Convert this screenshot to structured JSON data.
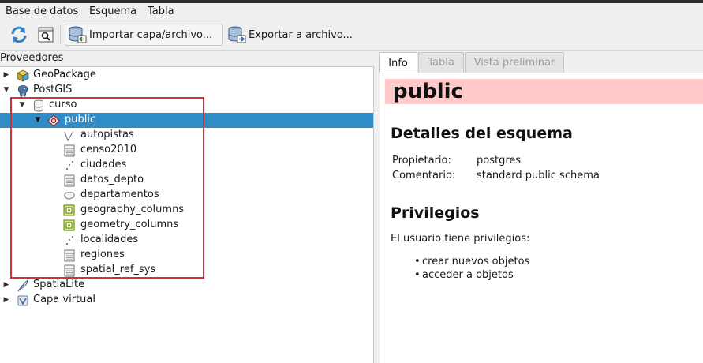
{
  "menu": [
    "Base de datos",
    "Esquema",
    "Tabla"
  ],
  "toolbar": {
    "refresh_icon": "refresh-icon",
    "sql_icon": "sql-window-icon",
    "import_label": "Importar capa/archivo...",
    "export_label": "Exportar a archivo..."
  },
  "left_panel": {
    "title": "Proveedores"
  },
  "tree": {
    "geopackage": "GeoPackage",
    "postgis": "PostGIS",
    "curso": "curso",
    "public": "public",
    "tables": [
      {
        "name": "autopistas",
        "icon": "line-layer-icon"
      },
      {
        "name": "censo2010",
        "icon": "table-icon"
      },
      {
        "name": "ciudades",
        "icon": "point-layer-icon"
      },
      {
        "name": "datos_depto",
        "icon": "table-icon"
      },
      {
        "name": "departamentos",
        "icon": "polygon-layer-icon"
      },
      {
        "name": "geography_columns",
        "icon": "view-icon"
      },
      {
        "name": "geometry_columns",
        "icon": "view-icon"
      },
      {
        "name": "localidades",
        "icon": "point-layer-icon"
      },
      {
        "name": "regiones",
        "icon": "table-icon"
      },
      {
        "name": "spatial_ref_sys",
        "icon": "table-icon"
      }
    ],
    "spatialite": "SpatiaLite",
    "virtual": "Capa virtual"
  },
  "tabs": [
    {
      "label": "Info",
      "active": true
    },
    {
      "label": "Tabla",
      "active": false
    },
    {
      "label": "Vista preliminar",
      "active": false
    }
  ],
  "info": {
    "schema_name": "public",
    "details_heading": "Detalles del esquema",
    "owner_key": "Propietario:",
    "owner_value": "postgres",
    "comment_key": "Comentario:",
    "comment_value": "standard public schema",
    "privileges_heading": "Privilegios",
    "privileges_text": "El usuario tiene privilegios:",
    "privileges": [
      "crear nuevos objetos",
      "acceder a objetos"
    ]
  },
  "colors": {
    "selection": "#308cc6",
    "schema_header_bg": "#ffc9c9",
    "highlight_box": "#d0343a"
  }
}
